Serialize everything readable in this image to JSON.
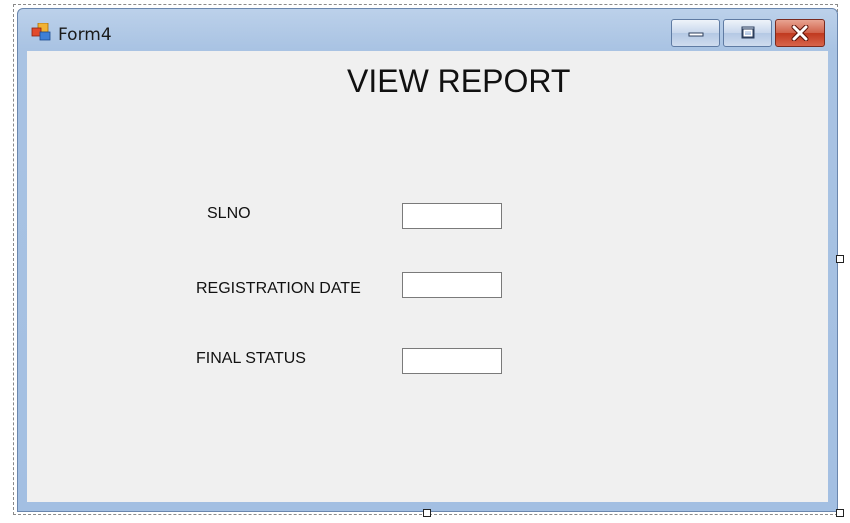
{
  "window": {
    "title": "Form4",
    "controls": {
      "minimize_icon": "minimize-icon",
      "maximize_icon": "maximize-icon",
      "close_icon": "close-icon"
    }
  },
  "form": {
    "heading": "VIEW REPORT",
    "fields": [
      {
        "label": "SLNO",
        "value": ""
      },
      {
        "label": "REGISTRATION DATE",
        "value": ""
      },
      {
        "label": "FINAL STATUS",
        "value": ""
      }
    ]
  },
  "colors": {
    "client_background": "#f0f0f0",
    "frame_blue": "#a9c3e3",
    "close_red": "#c0391f"
  }
}
